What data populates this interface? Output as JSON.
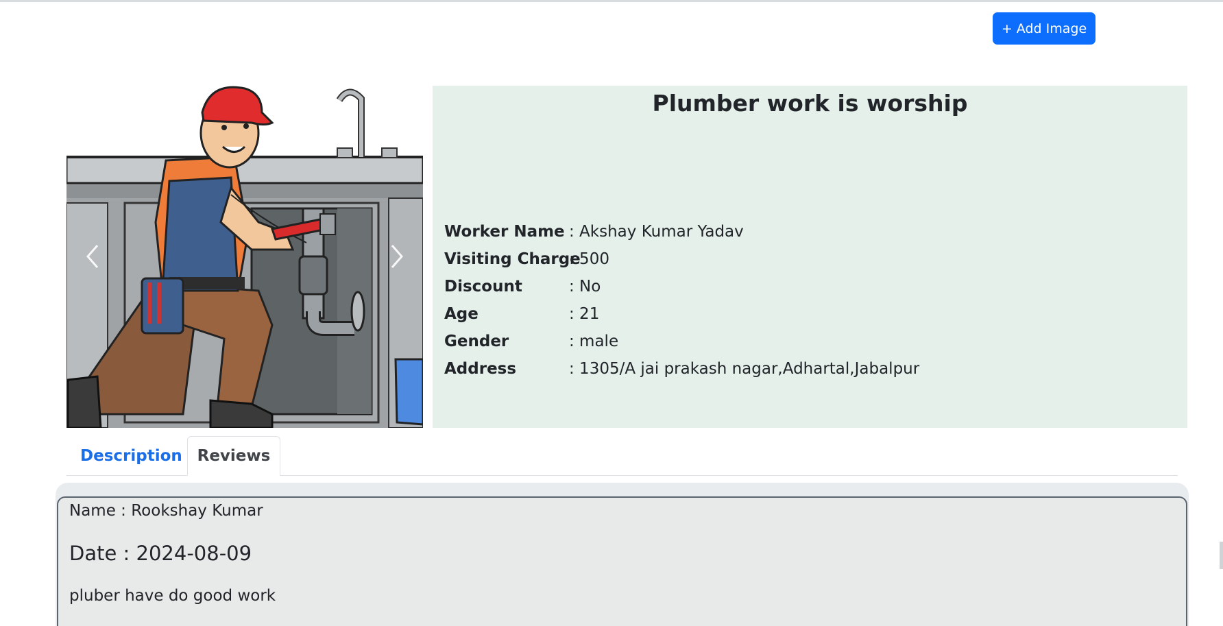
{
  "toolbar": {
    "add_image_label": "+ Add Image"
  },
  "carousel": {
    "prev_icon": "chevron-left-icon",
    "next_icon": "chevron-right-icon"
  },
  "worker": {
    "title": "Plumber work is worship",
    "fields": [
      {
        "label": "Worker Name",
        "value": ": Akshay Kumar Yadav"
      },
      {
        "label": "Visiting Charge",
        "value": ": 500"
      },
      {
        "label": "Discount",
        "value": ": No"
      },
      {
        "label": "Age",
        "value": ": 21"
      },
      {
        "label": "Gender",
        "value": ": male"
      },
      {
        "label": "Address",
        "value": ": 1305/A jai prakash nagar,Adhartal,Jabalpur"
      }
    ]
  },
  "tabs": [
    {
      "label": "Description",
      "active": false
    },
    {
      "label": "Reviews",
      "active": true
    }
  ],
  "reviews": [
    {
      "name": "Name : Rookshay Kumar",
      "date": "Date : 2024-08-09",
      "text": "pluber have do good work"
    }
  ],
  "colors": {
    "primary": "#0d6efd",
    "panel": "#e6f0eb",
    "review_bg": "#e9ecef",
    "link": "#1a6fe8"
  }
}
